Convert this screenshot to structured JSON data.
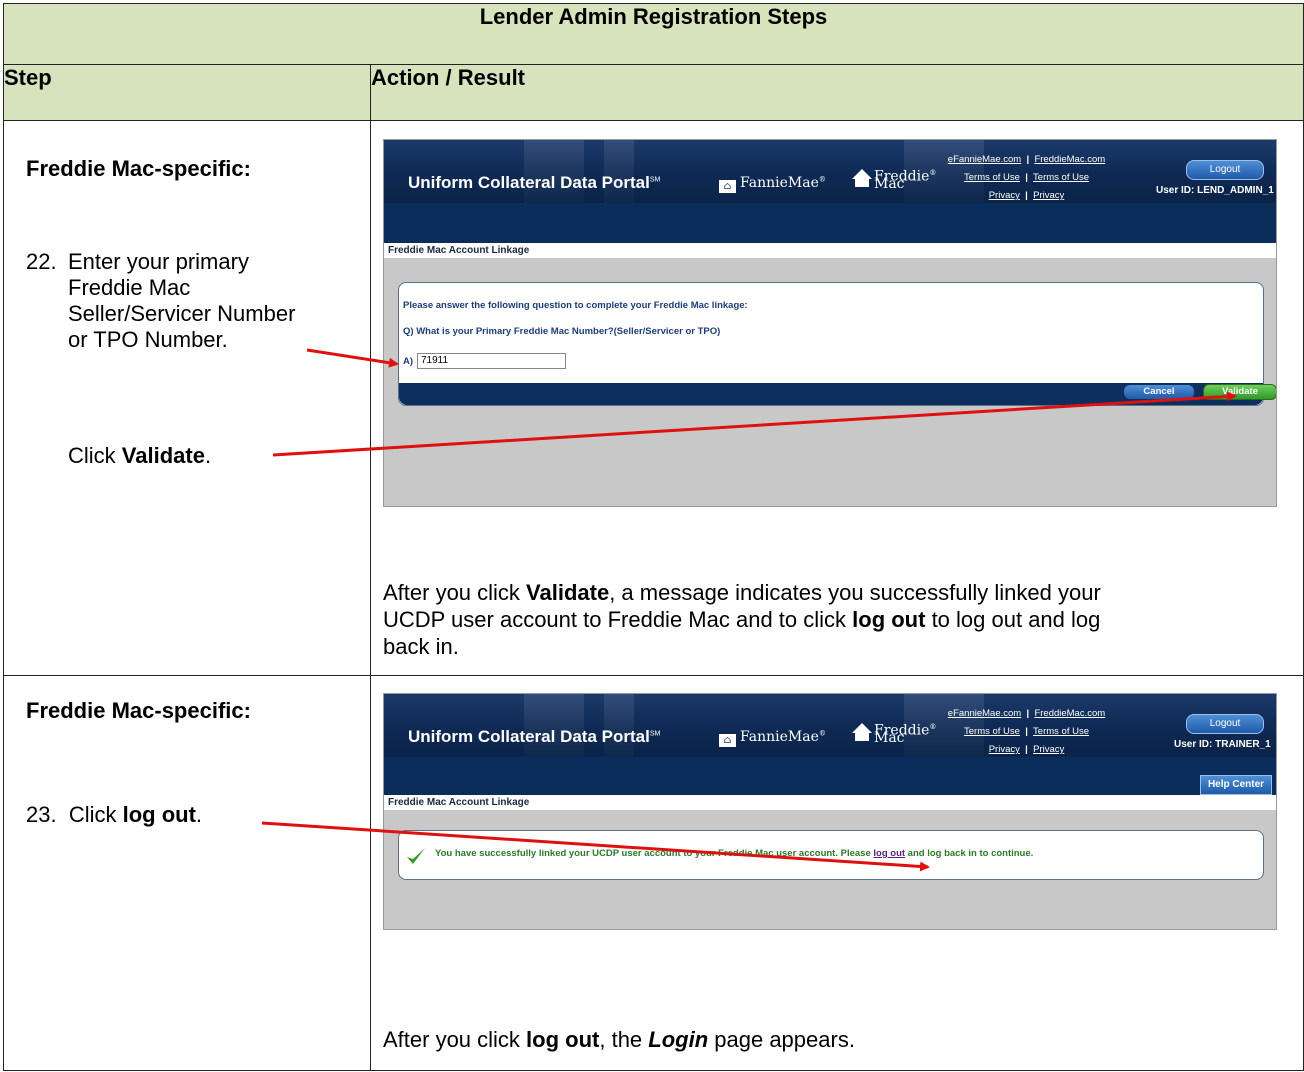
{
  "table": {
    "title": "Lender Admin Registration Steps",
    "col_step": "Step",
    "col_action": "Action / Result"
  },
  "step22": {
    "heading": "Freddie Mac-specific:",
    "num": "22.",
    "line1": "Enter your primary",
    "line2": "Freddie Mac",
    "line3": "Seller/Servicer Number",
    "line4": "or TPO Number.",
    "click_prefix": "Click ",
    "click_bold": "Validate",
    "click_suffix": "."
  },
  "step23": {
    "heading": "Freddie Mac-specific:",
    "num": "23.",
    "click_prefix": "Click ",
    "click_bold": "log out",
    "click_suffix": "."
  },
  "result22": {
    "p1": "After you click ",
    "b1": "Validate",
    "p2": ", a message indicates you successfully linked your",
    "line2": "UCDP user account to Freddie Mac and to click ",
    "b2": "log out",
    "p3": " to log out and log",
    "line3": "back in."
  },
  "result23": {
    "p1": "After you click ",
    "b1": "log out",
    "p2": ", the ",
    "b2": "Login",
    "p3": " page appears."
  },
  "portal": {
    "title": "Uniform Collateral Data Portal",
    "sm": "SM",
    "fannie": "FannieMae",
    "fannie_reg": "®",
    "freddie1": "Freddie",
    "freddie2": "Mac",
    "freddie_reg": "®",
    "link_efannie": "eFannieMae.com",
    "link_freddie": "FreddieMac.com",
    "terms": "Terms of Use",
    "privacy": "Privacy",
    "sep": "|",
    "logout": "Logout",
    "page_label": "Freddie Mac Account Linkage"
  },
  "shot1": {
    "user_id": "User ID: LEND_ADMIN_1",
    "prompt": "Please answer the following question to complete your Freddie Mac linkage:",
    "question": "Q) What is your Primary Freddie Mac Number?(Seller/Servicer or TPO)",
    "answer_label": "A)",
    "answer_value": "71911",
    "cancel": "Cancel",
    "validate": "Validate"
  },
  "shot2": {
    "user_id": "User ID: TRAINER_1",
    "help": "Help Center",
    "msg_pre": "You have successfully linked your UCDP user account to your Freddie Mac user account. Please ",
    "msg_link": "log out",
    "msg_post": " and log back in to continue."
  },
  "colors": {
    "header_bg": "#d6e3bc",
    "portal_navy": "#0b2d5b",
    "arrow": "#e01010",
    "validate_green": "#2f9a2a"
  }
}
